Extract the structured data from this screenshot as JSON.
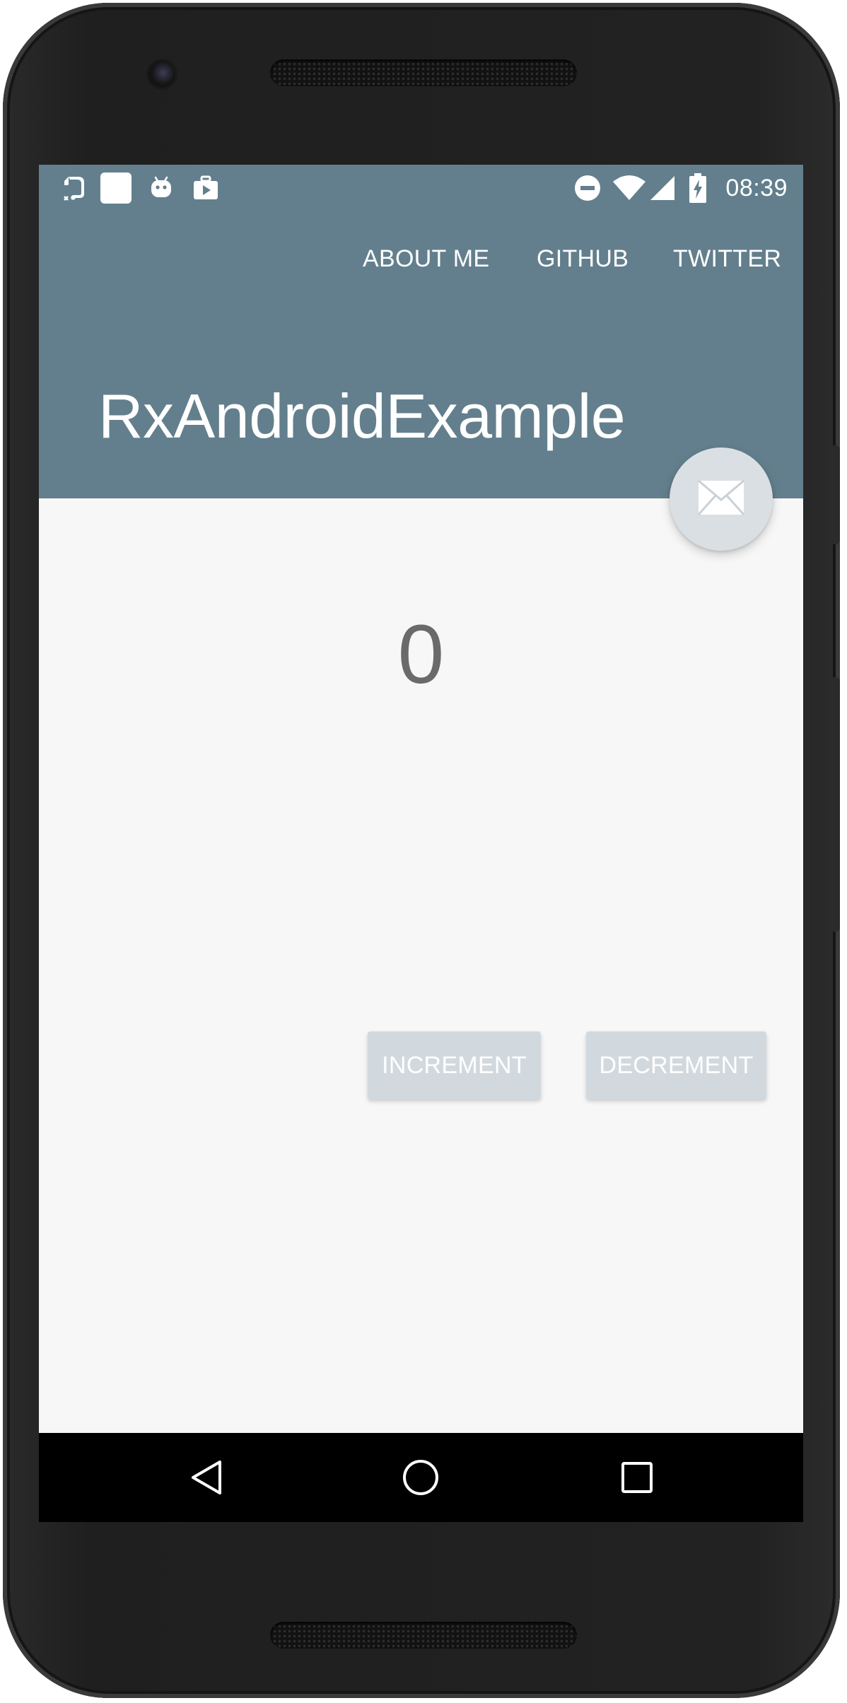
{
  "status_bar": {
    "time": "08:39",
    "icons_left": [
      "evernote-icon",
      "blank-square-icon",
      "android-debug-icon",
      "media-briefcase-icon"
    ],
    "icons_right": [
      "do-not-disturb-icon",
      "wifi-icon",
      "cellular-signal-icon",
      "battery-charging-icon"
    ]
  },
  "toolbar": {
    "menu": {
      "about": "ABOUT ME",
      "github": "GITHUB",
      "twitter": "TWITTER"
    },
    "title": "RxAndroidExample"
  },
  "fab": {
    "icon": "email-icon"
  },
  "counter": {
    "value": "0"
  },
  "buttons": {
    "increment": "INCREMENT",
    "decrement": "DECREMENT"
  },
  "nav_bar": {
    "icons": [
      "back-icon",
      "home-icon",
      "recents-icon"
    ]
  },
  "colors": {
    "app_bar": "#637f8d",
    "screen_bg": "#f7f7f7",
    "button_bg": "#d2d9de",
    "fab_bg": "#d9dfe3",
    "counter_text": "#6a6a6a"
  }
}
